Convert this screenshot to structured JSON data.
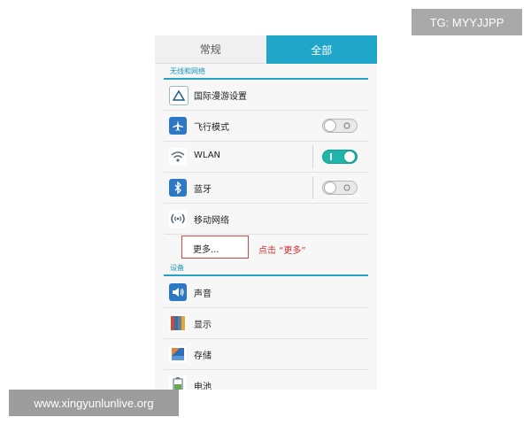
{
  "watermarks": {
    "top": "TG: MYYJJPP",
    "bottom": "www.xingyunlunlive.org"
  },
  "tabs": [
    {
      "label": "常规"
    },
    {
      "label": "全部"
    }
  ],
  "sections": [
    {
      "label": "无线和网络"
    },
    {
      "label": "设备"
    }
  ],
  "wireless_items": [
    {
      "label": "国际漫游设置",
      "icon": "roaming-triangle-icon"
    },
    {
      "label": "飞行模式",
      "icon": "airplane-icon",
      "toggle": "off"
    },
    {
      "label": "WLAN",
      "icon": "wifi-icon",
      "toggle": "on"
    },
    {
      "label": "蓝牙",
      "icon": "bluetooth-icon",
      "toggle": "off"
    },
    {
      "label": "移动网络",
      "icon": "mobile-network-icon"
    },
    {
      "label": "更多..."
    }
  ],
  "device_items": [
    {
      "label": "声音",
      "icon": "speaker-icon"
    },
    {
      "label": "显示",
      "icon": "display-icon"
    },
    {
      "label": "存储",
      "icon": "storage-icon"
    },
    {
      "label": "电池",
      "icon": "battery-icon"
    }
  ],
  "annotation": {
    "text": "点击 “更多”",
    "color": "#d32f2f"
  },
  "colors": {
    "accent": "#20a6c9",
    "toggle_on": "#1eb6a9"
  }
}
